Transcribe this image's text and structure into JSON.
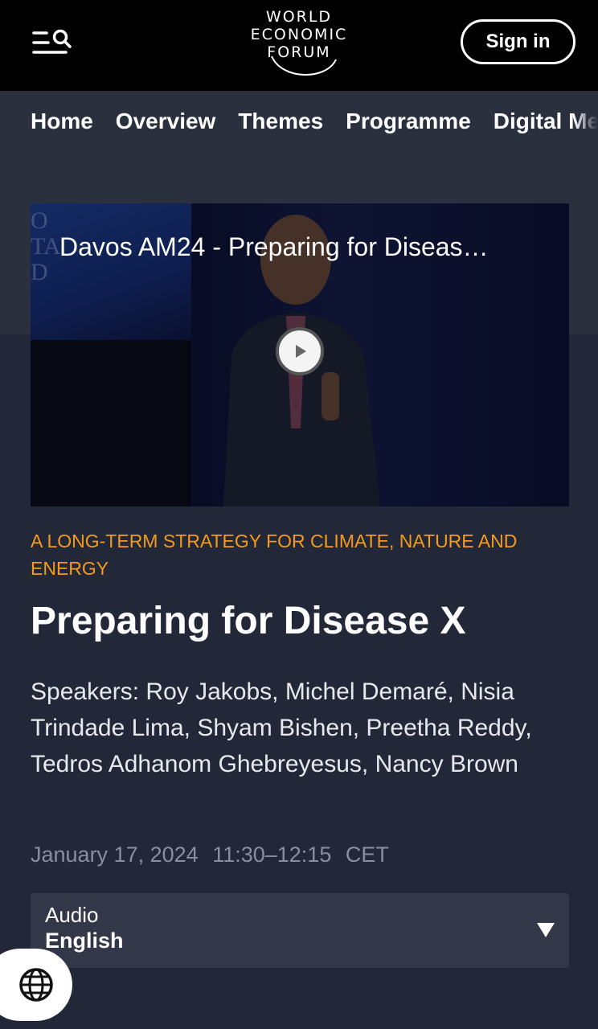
{
  "header": {
    "logo_lines": [
      "WORLD",
      "ECONOMIC",
      "FORUM"
    ],
    "sign_in_label": "Sign in",
    "menu_icon": "menu-search-icon"
  },
  "nav": {
    "items": [
      {
        "label": "Home"
      },
      {
        "label": "Overview"
      },
      {
        "label": "Themes"
      },
      {
        "label": "Programme"
      },
      {
        "label": "Digital Media"
      }
    ]
  },
  "video": {
    "title": "Davos AM24 - Preparing for Diseas…",
    "play_icon": "play-icon"
  },
  "session": {
    "category": "A LONG-TERM STRATEGY FOR CLIMATE, NATURE AND ENERGY",
    "title": "Preparing for Disease X",
    "speakers": "Speakers: Roy Jakobs, Michel Demaré, Nisia Trindade Lima, Shyam Bishen, Preetha Reddy, Tedros Adhanom Ghebreyesus, Nancy Brown",
    "date": "January 17, 2024",
    "time": "11:30–12:15",
    "timezone": "CET"
  },
  "audio": {
    "label": "Audio",
    "selected": "English"
  },
  "language_button_icon": "globe-icon",
  "colors": {
    "accent": "#f59a1c",
    "background": "#232838",
    "topbar": "#000000"
  }
}
